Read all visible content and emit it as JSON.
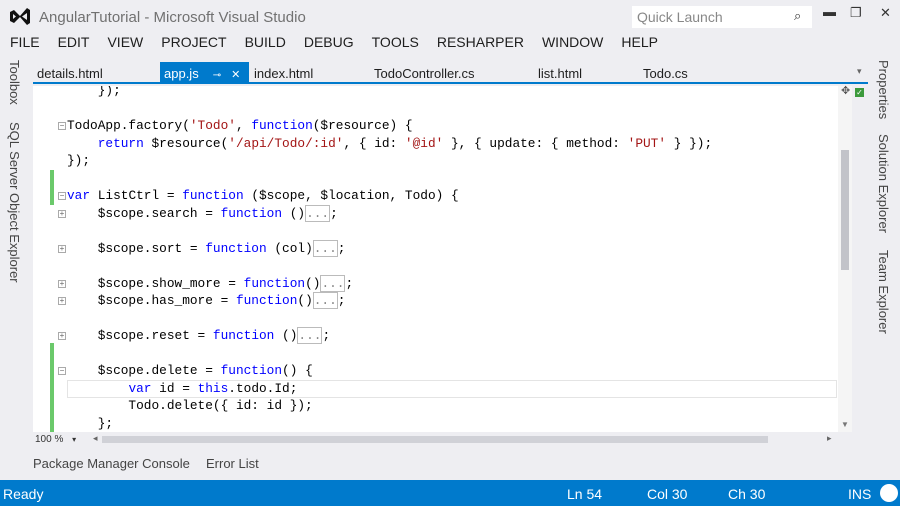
{
  "window": {
    "title": "AngularTutorial - Microsoft Visual Studio",
    "quick_launch_placeholder": "Quick Launch"
  },
  "menu": [
    "FILE",
    "EDIT",
    "VIEW",
    "PROJECT",
    "BUILD",
    "DEBUG",
    "TOOLS",
    "RESHARPER",
    "WINDOW",
    "HELP"
  ],
  "left_panels": [
    "Toolbox",
    "SQL Server Object Explorer"
  ],
  "right_panels": [
    "Properties",
    "Solution Explorer",
    "Team Explorer"
  ],
  "tabs": [
    {
      "label": "details.html"
    },
    {
      "label": "app.js",
      "active": true
    },
    {
      "label": "index.html"
    },
    {
      "label": "TodoController.cs"
    },
    {
      "label": "list.html"
    },
    {
      "label": "Todo.cs"
    }
  ],
  "code": [
    [
      [
        "    });",
        "pl"
      ]
    ],
    [],
    [
      [
        "TodoApp.factory(",
        "pl"
      ],
      [
        "'Todo'",
        "str"
      ],
      [
        ", ",
        "pl"
      ],
      [
        "function",
        "kw"
      ],
      [
        "($resource) {",
        "pl"
      ]
    ],
    [
      [
        "    ",
        "pl"
      ],
      [
        "return",
        "kw"
      ],
      [
        " $resource(",
        "pl"
      ],
      [
        "'/api/Todo/:id'",
        "str"
      ],
      [
        ", { id: ",
        "pl"
      ],
      [
        "'@id'",
        "str"
      ],
      [
        " }, { update: { method: ",
        "pl"
      ],
      [
        "'PUT'",
        "str"
      ],
      [
        " } });",
        "pl"
      ]
    ],
    [
      [
        "});",
        "pl"
      ]
    ],
    [],
    [
      [
        "var",
        "kw"
      ],
      [
        " ListCtrl = ",
        "pl"
      ],
      [
        "function",
        "kw"
      ],
      [
        " ($scope, $location, Todo) {",
        "pl"
      ]
    ],
    [
      [
        "    $scope.search = ",
        "pl"
      ],
      [
        "function",
        "kw"
      ],
      [
        " ()",
        "pl"
      ],
      [
        "...",
        "col"
      ],
      [
        ";",
        "pl"
      ]
    ],
    [],
    [
      [
        "    $scope.sort = ",
        "pl"
      ],
      [
        "function",
        "kw"
      ],
      [
        " (col)",
        "pl"
      ],
      [
        "...",
        "col"
      ],
      [
        ";",
        "pl"
      ]
    ],
    [],
    [
      [
        "    $scope.show_more = ",
        "pl"
      ],
      [
        "function",
        "kw"
      ],
      [
        "()",
        "pl"
      ],
      [
        "...",
        "col"
      ],
      [
        ";",
        "pl"
      ]
    ],
    [
      [
        "    $scope.has_more = ",
        "pl"
      ],
      [
        "function",
        "kw"
      ],
      [
        "()",
        "pl"
      ],
      [
        "...",
        "col"
      ],
      [
        ";",
        "pl"
      ]
    ],
    [],
    [
      [
        "    $scope.reset = ",
        "pl"
      ],
      [
        "function",
        "kw"
      ],
      [
        " ()",
        "pl"
      ],
      [
        "...",
        "col"
      ],
      [
        ";",
        "pl"
      ]
    ],
    [],
    [
      [
        "    $scope.delete = ",
        "pl"
      ],
      [
        "function",
        "kw"
      ],
      [
        "() {",
        "pl"
      ]
    ],
    [
      [
        "        ",
        "pl"
      ],
      [
        "var",
        "kw"
      ],
      [
        " id = ",
        "pl"
      ],
      [
        "this",
        "kw"
      ],
      [
        ".todo.Id;",
        "pl"
      ]
    ],
    [
      [
        "        Todo.delete({ id: id });",
        "pl"
      ]
    ],
    [
      [
        "    };",
        "pl"
      ]
    ]
  ],
  "editor": {
    "zoom": "100 %"
  },
  "bottom_tabs": [
    "Package Manager Console",
    "Error List"
  ],
  "status": {
    "text": "Ready",
    "line": "Ln 54",
    "col": "Col 30",
    "ch": "Ch 30",
    "mode": "INS"
  },
  "colors": {
    "accent": "#007acc",
    "keyword": "#0000ff",
    "string": "#a31515"
  }
}
